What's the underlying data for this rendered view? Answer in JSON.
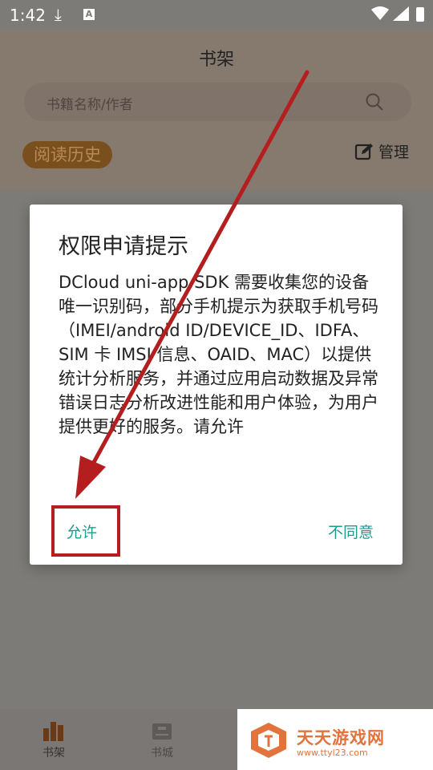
{
  "status_bar": {
    "time": "1:42"
  },
  "header": {
    "title": "书架"
  },
  "search": {
    "placeholder": "书籍名称/作者"
  },
  "toolbar": {
    "history_label": "阅读历史",
    "manage_label": "管理"
  },
  "dialog": {
    "title": "权限申请提示",
    "body": "DCloud uni-app SDK 需要收集您的设备唯一识别码，部分手机提示为获取手机号码（IMEI/android ID/DEVICE_ID、IDFA、SIM 卡 IMSI 信息、OAID、MAC）以提供统计分析服务，并通过应用启动数据及异常错误日志分析改进性能和用户体验，为用户提供更好的服务。请允许",
    "allow_label": "允许",
    "deny_label": "不同意"
  },
  "tabbar": {
    "items": [
      {
        "label": "书架",
        "icon": "bookshelf-icon"
      },
      {
        "label": "书城",
        "icon": "store-icon"
      }
    ]
  },
  "watermark": {
    "name": "天天游戏网",
    "url": "www.ttyl23.com"
  },
  "colors": {
    "accent": "#1d9b91",
    "highlight": "#b41e1e",
    "watermark": "#e2733c"
  }
}
